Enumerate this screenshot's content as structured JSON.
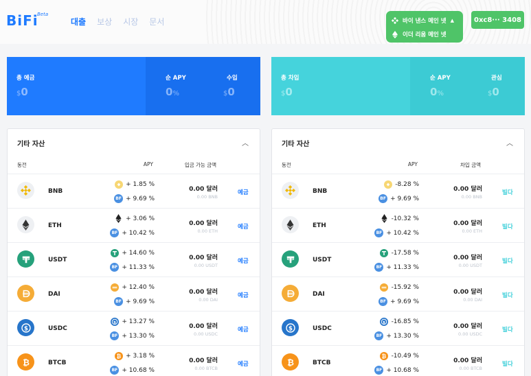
{
  "header": {
    "logo": "BiFi",
    "logo_beta": "Beta",
    "nav": [
      {
        "label": "대출",
        "active": true
      },
      {
        "label": "보상",
        "active": false
      },
      {
        "label": "시장",
        "active": false
      },
      {
        "label": "문서",
        "active": false
      }
    ],
    "networks": [
      {
        "label": "바이 낸스 메인 넷",
        "icon": "binance-icon"
      },
      {
        "label": "이더 리움 메인 넷",
        "icon": "ethereum-icon"
      }
    ],
    "wallet": "0xc8··· 3408"
  },
  "summary": {
    "deposit": {
      "label": "총 예금",
      "currency": "$",
      "value": "0",
      "apy_label": "순 APY",
      "apy_value": "0",
      "apy_unit": "%",
      "income_label": "수입",
      "income_currency": "$",
      "income_value": "0"
    },
    "borrow": {
      "label": "총 차입",
      "currency": "$",
      "value": "0",
      "apy_label": "순 APY",
      "apy_value": "0",
      "apy_unit": "%",
      "interest_label": "관심",
      "interest_currency": "$",
      "interest_value": "0"
    }
  },
  "deposit_panel": {
    "title": "기타 자산",
    "columns": {
      "coin": "동전",
      "apy": "APY",
      "amount": "입금 가능 금액"
    },
    "action": "예금",
    "rows": [
      {
        "name": "BNB",
        "apy1": "+ 1.85 %",
        "apy2": "+ 9.69 %",
        "amount": "0.00 달러",
        "sub": "0.00 BNB"
      },
      {
        "name": "ETH",
        "apy1": "+ 3.06 %",
        "apy2": "+ 10.42 %",
        "amount": "0.00 달러",
        "sub": "0.00 ETH"
      },
      {
        "name": "USDT",
        "apy1": "+ 14.60 %",
        "apy2": "+ 11.33 %",
        "amount": "0.00 달러",
        "sub": "0.00 USDT"
      },
      {
        "name": "DAI",
        "apy1": "+ 12.40 %",
        "apy2": "+ 9.69 %",
        "amount": "0.00 달러",
        "sub": "0.00 DAI"
      },
      {
        "name": "USDC",
        "apy1": "+ 13.27 %",
        "apy2": "+ 13.30 %",
        "amount": "0.00 달러",
        "sub": "0.00 USDC"
      },
      {
        "name": "BTCB",
        "apy1": "+ 3.18 %",
        "apy2": "+ 10.68 %",
        "amount": "0.00 달러",
        "sub": "0.00 BTCB"
      }
    ]
  },
  "borrow_panel": {
    "title": "기타 자산",
    "columns": {
      "coin": "동전",
      "apy": "APY",
      "amount": "차입 금액"
    },
    "action": "빌다",
    "rows": [
      {
        "name": "BNB",
        "apy1": "-8.28 %",
        "apy2": "+ 9.69 %",
        "amount": "0.00 달러",
        "sub": "0.00 BNB"
      },
      {
        "name": "ETH",
        "apy1": "-10.32 %",
        "apy2": "+ 10.42 %",
        "amount": "0.00 달러",
        "sub": "0.00 ETH"
      },
      {
        "name": "USDT",
        "apy1": "-17.58 %",
        "apy2": "+ 11.33 %",
        "amount": "0.00 달러",
        "sub": "0.00 USDT"
      },
      {
        "name": "DAI",
        "apy1": "-15.92 %",
        "apy2": "+ 9.69 %",
        "amount": "0.00 달러",
        "sub": "0.00 DAI"
      },
      {
        "name": "USDC",
        "apy1": "-16.85 %",
        "apy2": "+ 13.30 %",
        "amount": "0.00 달러",
        "sub": "0.00 USDC"
      },
      {
        "name": "BTCB",
        "apy1": "-10.49 %",
        "apy2": "+ 10.68 %",
        "amount": "0.00 달러",
        "sub": "0.00 BTCB"
      }
    ]
  },
  "bifi_token_label": "BF",
  "colors": {
    "primary": "#1f7bff",
    "teal": "#3ecfd9",
    "green": "#4fc468",
    "deposit_action": "#1f7bff",
    "borrow_action": "#3ecfd9"
  }
}
